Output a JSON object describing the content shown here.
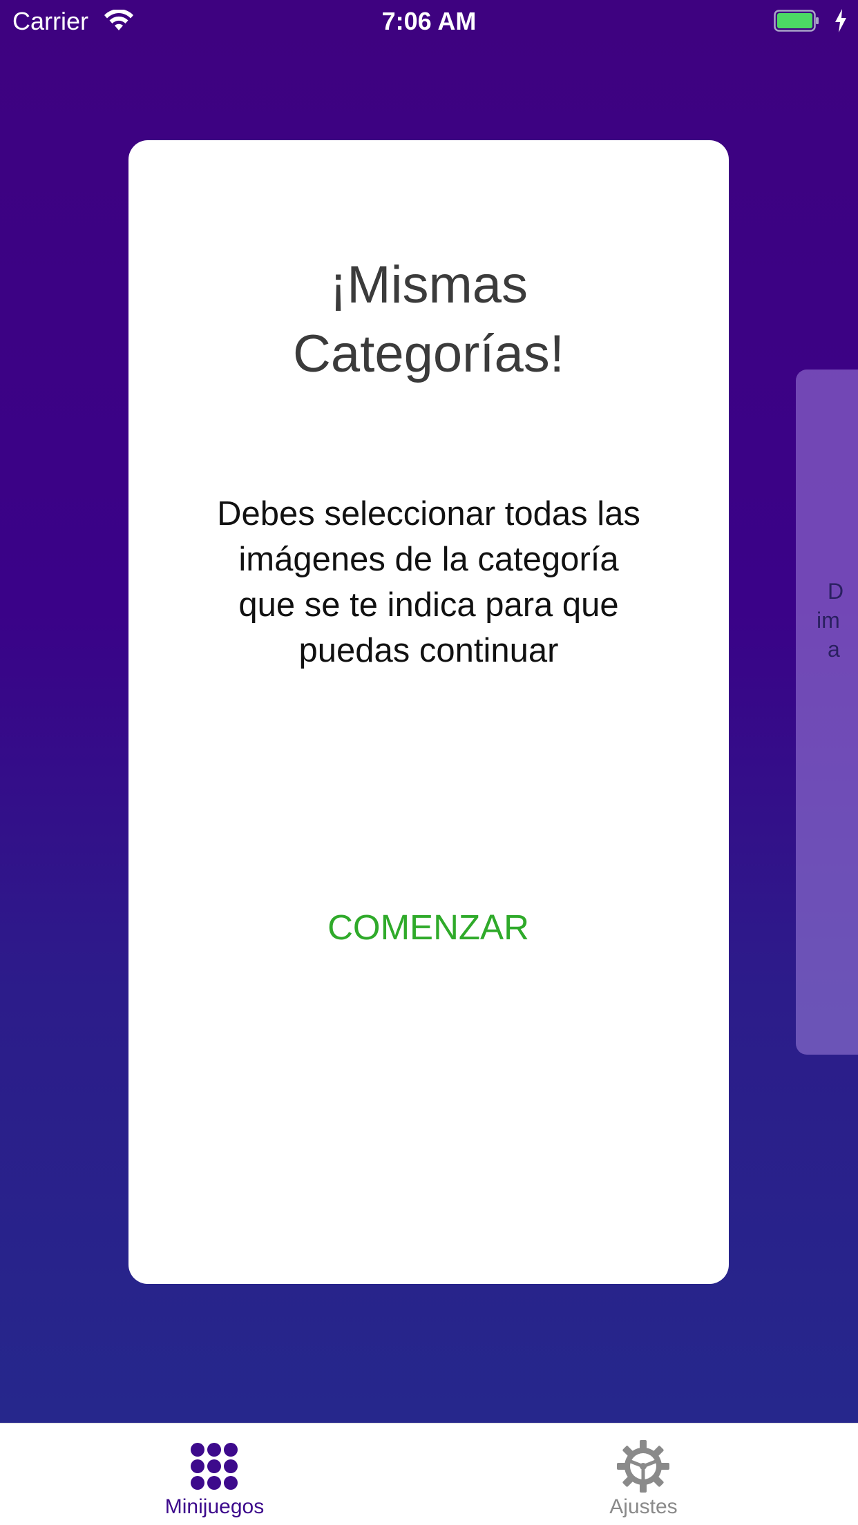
{
  "status_bar": {
    "carrier": "Carrier",
    "time": "7:06 AM",
    "battery_color": "#4cd964"
  },
  "card": {
    "title_line1": "¡Mismas",
    "title_line2": "Categorías!",
    "description_lines": [
      "Debes seleccionar todas las",
      "imágenes de la categoría",
      "que se te indica para que",
      "puedas continuar"
    ],
    "button_label": "COMENZAR",
    "button_color": "#2faa2a"
  },
  "next_card": {
    "partial_lines": [
      "D",
      "im",
      "a"
    ]
  },
  "tab_bar": {
    "active_color": "#3d0a8c",
    "inactive_color": "#8a8a8a",
    "tabs": [
      {
        "label": "Minijuegos",
        "icon": "grid-dots-icon",
        "active": true
      },
      {
        "label": "Ajustes",
        "icon": "gear-icon",
        "active": false
      }
    ]
  },
  "theme": {
    "background_top": "#3e0280",
    "background_bottom": "#242a8c"
  }
}
